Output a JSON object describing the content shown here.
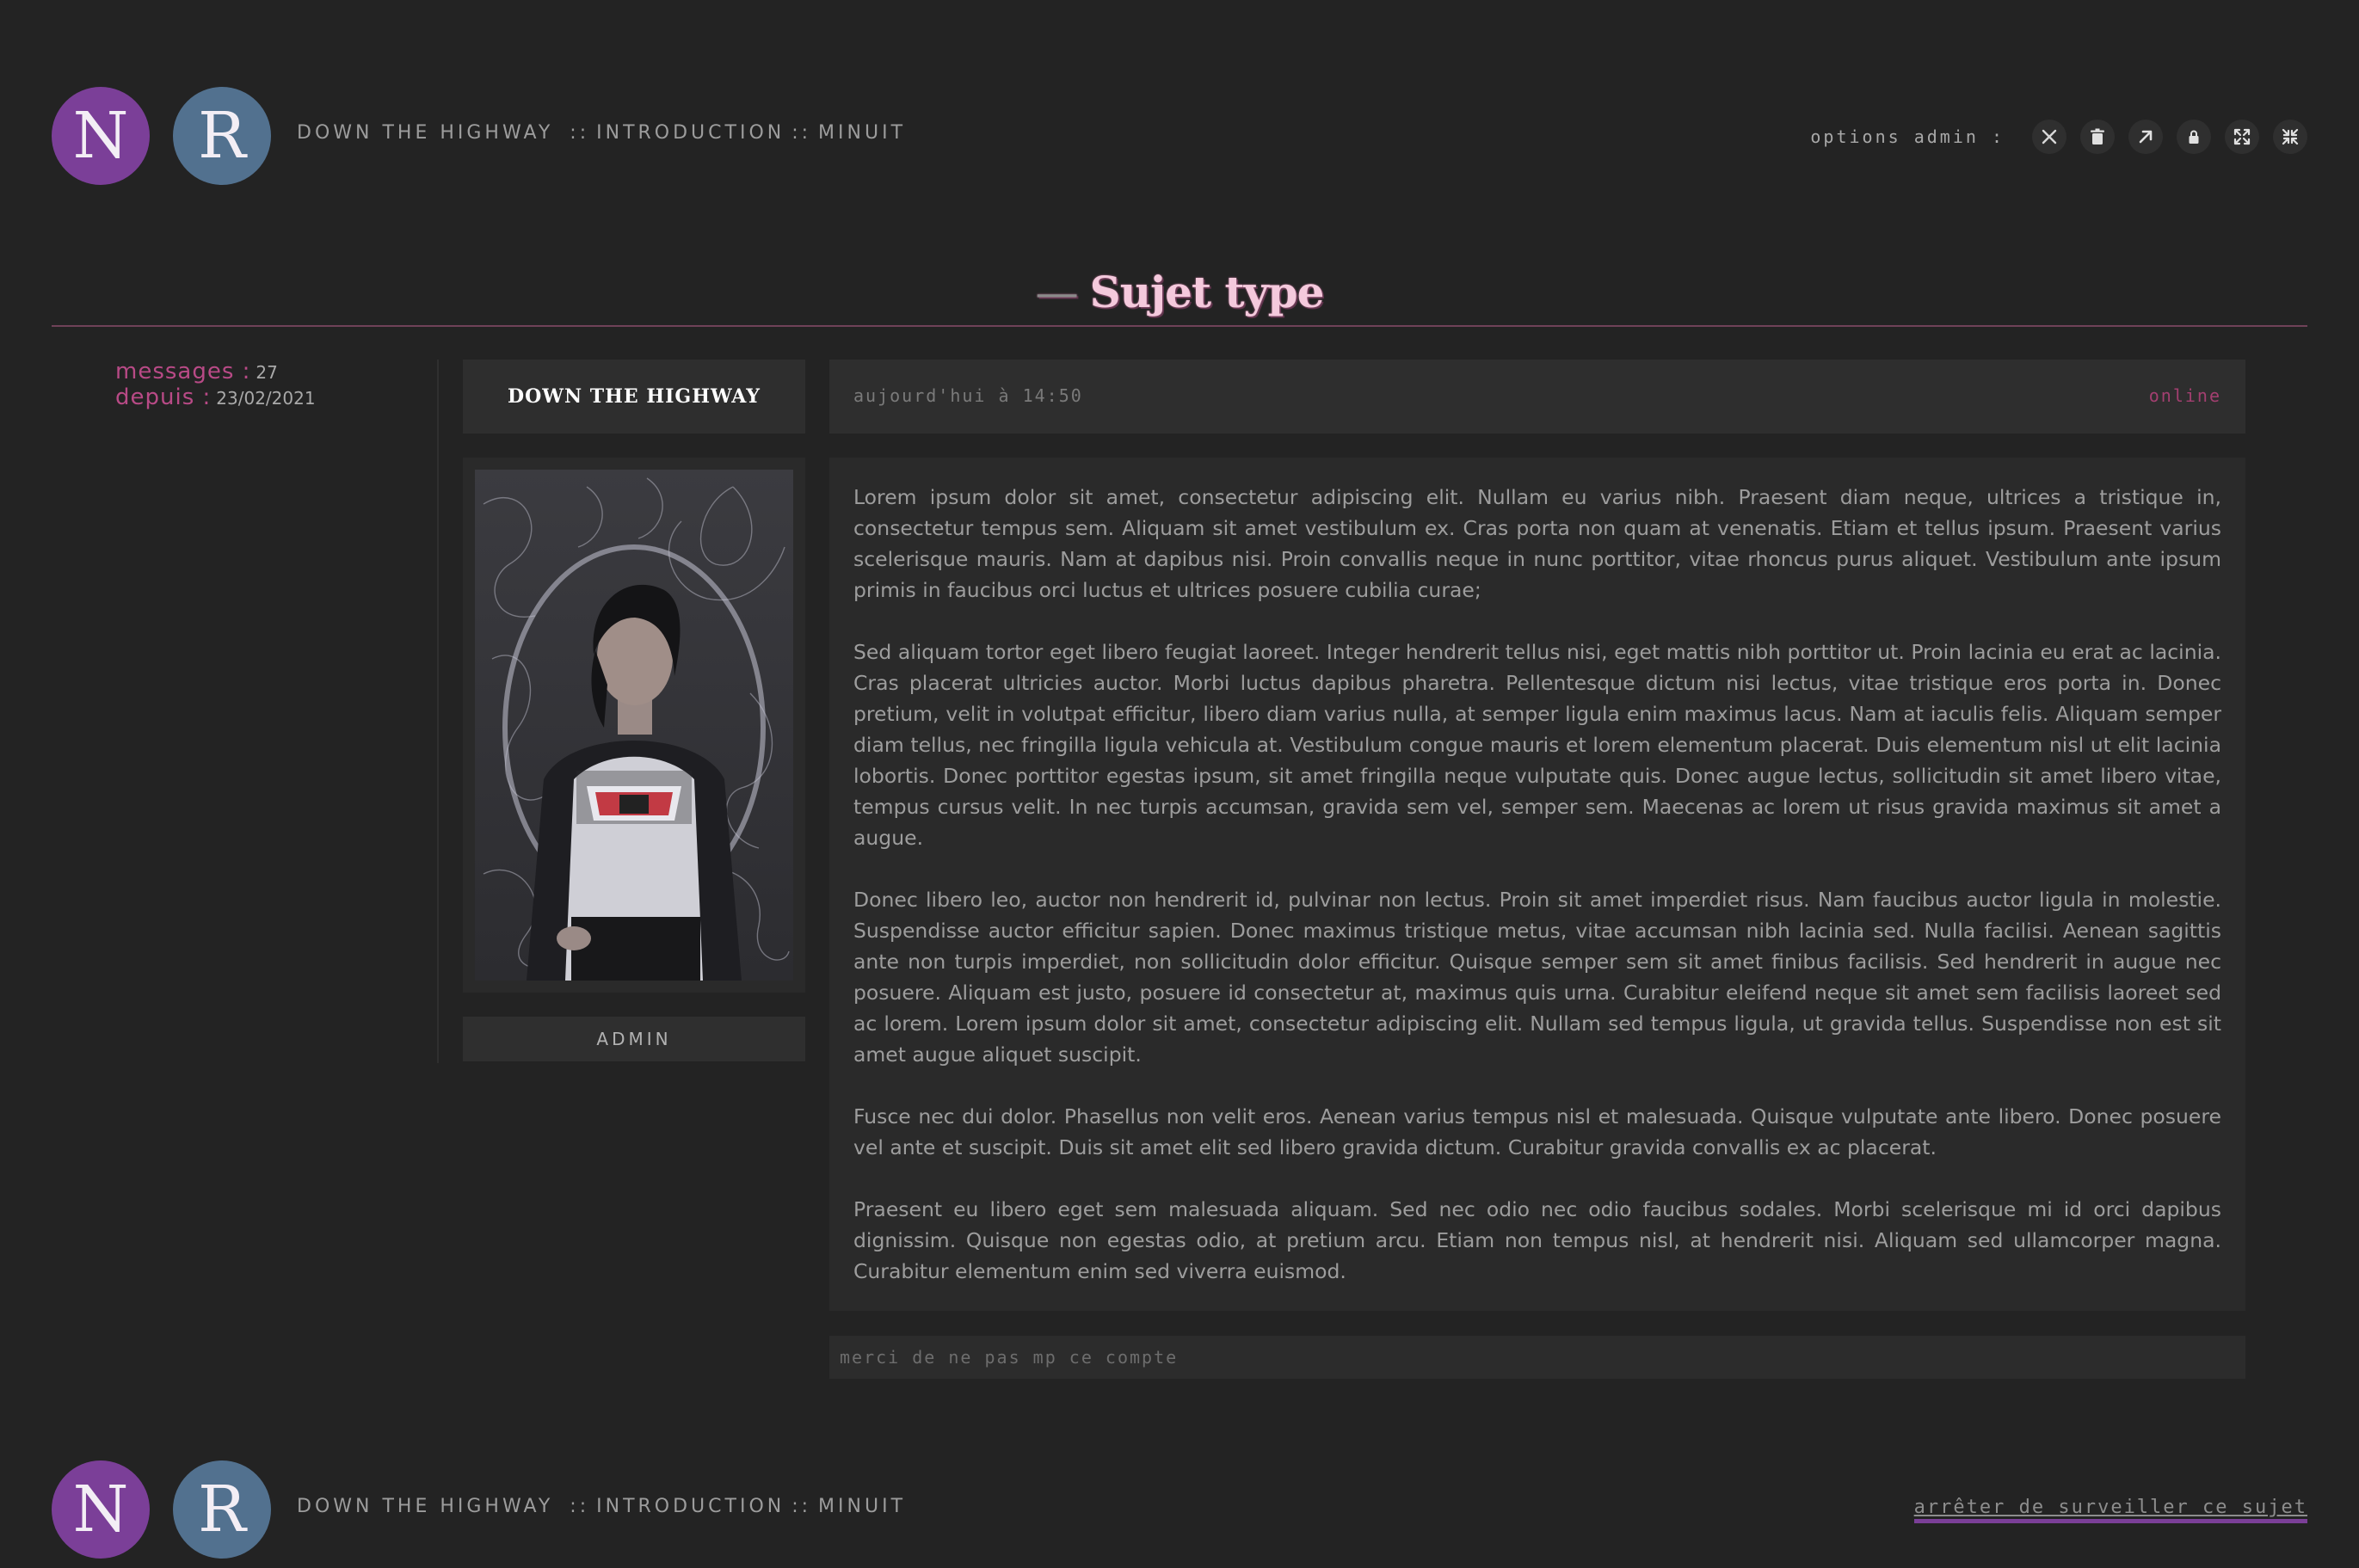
{
  "header": {
    "logo_letters": [
      "N",
      "R"
    ],
    "breadcrumb": [
      "DOWN THE HIGHWAY",
      "INTRODUCTION",
      "MINUIT"
    ],
    "breadcrumb_separator": "::",
    "admin_label": "options admin :",
    "admin_icons": [
      "close-icon",
      "trash-icon",
      "move-arrow-icon",
      "lock-icon",
      "expand-icon",
      "collapse-icon"
    ]
  },
  "topic": {
    "dash": "—",
    "title": "Sujet type"
  },
  "author": {
    "messages_label": "messages :",
    "messages_value": "27",
    "since_label": "depuis :",
    "since_value": "23/02/2021",
    "name": "DOWN THE HIGHWAY",
    "rank": "ADMIN"
  },
  "post": {
    "date": "aujourd'hui à 14:50",
    "status": "online",
    "paragraphs": [
      "Lorem ipsum dolor sit amet, consectetur adipiscing elit. Nullam eu varius nibh. Praesent diam neque, ultrices a tristique in, consectetur tempus sem. Aliquam sit amet vestibulum ex. Cras porta non quam at venenatis. Etiam et tellus ipsum. Praesent varius scelerisque mauris. Nam at dapibus nisi. Proin convallis neque in nunc porttitor, vitae rhoncus purus aliquet. Vestibulum ante ipsum primis in faucibus orci luctus et ultrices posuere cubilia curae;",
      "Sed aliquam tortor eget libero feugiat laoreet. Integer hendrerit tellus nisi, eget mattis nibh porttitor ut. Proin lacinia eu erat ac lacinia. Cras placerat ultricies auctor. Morbi luctus dapibus pharetra. Pellentesque dictum nisi lectus, vitae tristique eros porta in. Donec pretium, velit in volutpat efficitur, libero diam varius nulla, at semper ligula enim maximus lacus. Nam at iaculis felis. Aliquam semper diam tellus, nec fringilla ligula vehicula at. Vestibulum congue mauris et lorem elementum placerat. Duis elementum nisl ut elit lacinia lobortis. Donec porttitor egestas ipsum, sit amet fringilla neque vulputate quis. Donec augue lectus, sollicitudin sit amet libero vitae, tempus cursus velit. In nec turpis accumsan, gravida sem vel, semper sem. Maecenas ac lorem ut risus gravida maximus sit amet a augue.",
      "Donec libero leo, auctor non hendrerit id, pulvinar non lectus. Proin sit amet imperdiet risus. Nam faucibus auctor ligula in molestie. Suspendisse auctor efficitur sapien. Donec maximus tristique metus, vitae accumsan nibh lacinia sed. Nulla facilisi. Aenean sagittis ante non turpis imperdiet, non sollicitudin dolor efficitur. Quisque semper sem sit amet finibus facilisis. Sed hendrerit in augue nec posuere. Aliquam est justo, posuere id consectetur at, maximus quis urna. Curabitur eleifend neque sit amet sem facilisis laoreet sed ac lorem. Lorem ipsum dolor sit amet, consectetur adipiscing elit. Nullam sed tempus ligula, ut gravida tellus. Suspendisse non est sit amet augue aliquet suscipit.",
      "Fusce nec dui dolor. Phasellus non velit eros. Aenean varius tempus nisl et malesuada. Quisque vulputate ante libero. Donec posuere vel ante et suscipit. Duis sit amet elit sed libero gravida dictum. Curabitur gravida convallis ex ac placerat.",
      "Praesent eu libero eget sem malesuada aliquam. Sed nec odio nec odio faucibus sodales. Morbi scelerisque mi id orci dapibus dignissim. Quisque non egestas odio, at pretium arcu. Etiam non tempus nisl, at hendrerit nisi. Aliquam sed ullamcorper magna. Curabitur elementum enim sed viverra euismod."
    ],
    "signature": "merci de ne pas mp ce compte"
  },
  "footer": {
    "watch_link": "arrêter de surveiller ce sujet"
  },
  "colors": {
    "background": "#232323",
    "accent_pink": "#b84a86",
    "accent_purple": "#7b3f98",
    "accent_blue": "#52718f",
    "title_pink": "#f4c9dc"
  }
}
